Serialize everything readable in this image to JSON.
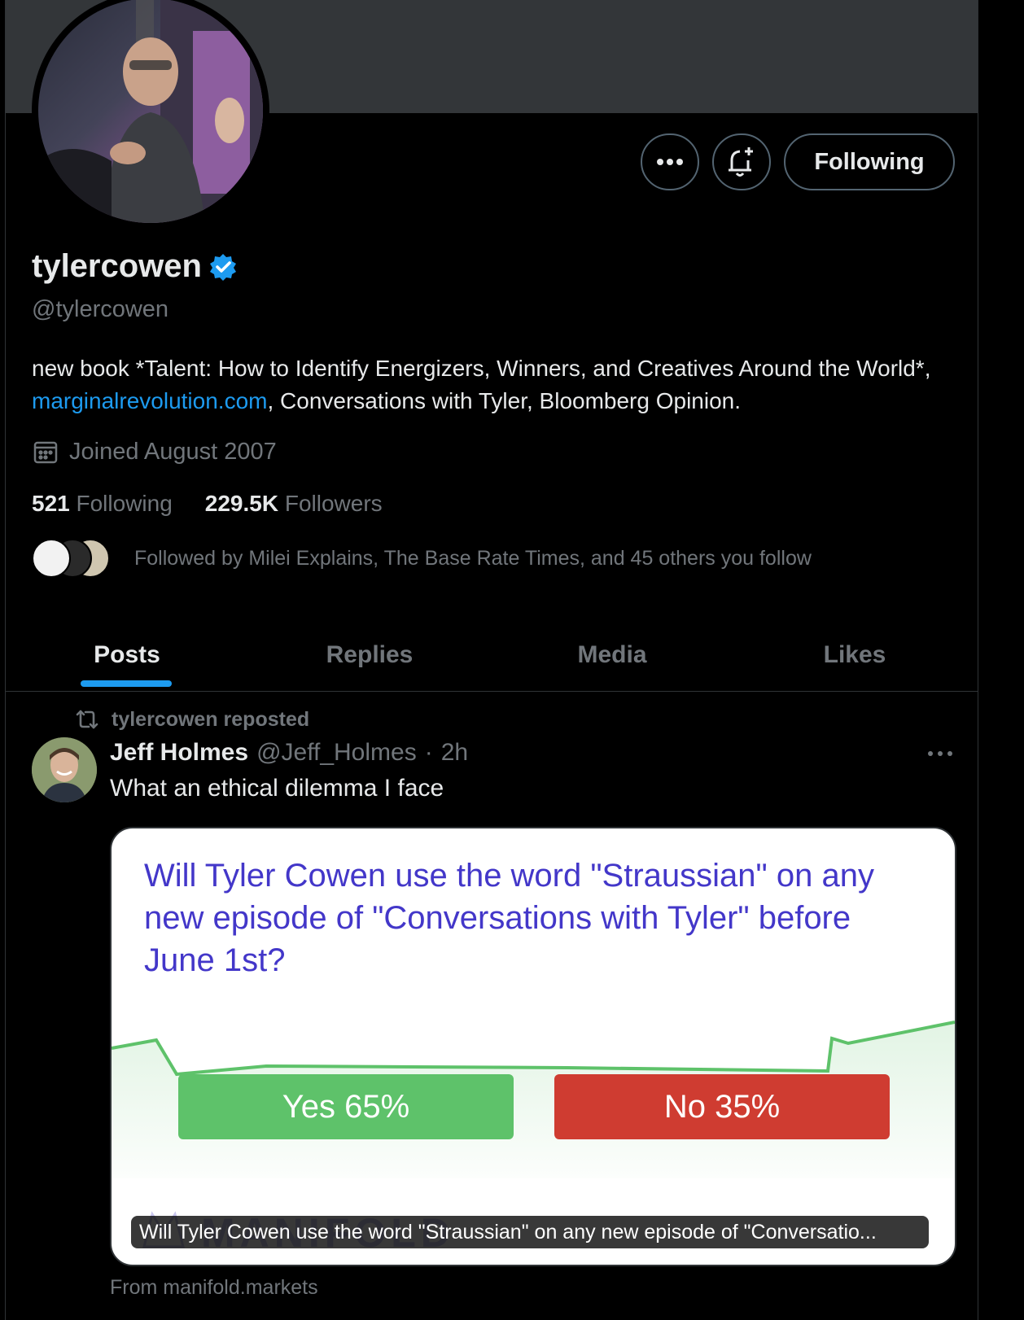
{
  "profile": {
    "display_name": "tylercowen",
    "handle": "@tylercowen",
    "bio_part1": "new book *Talent: How to Identify Energizers, Winners, and Creatives Around the World*, ",
    "bio_link": "marginalrevolution.com",
    "bio_part2": ", Conversations with Tyler, Bloomberg Opinion.",
    "joined": "Joined August 2007",
    "following_count": "521",
    "following_label": "Following",
    "followers_count": "229.5K",
    "followers_label": "Followers",
    "followed_by": "Followed by Milei Explains, The Base Rate Times, and 45 others you follow"
  },
  "actions": {
    "more_icon": "ellipsis-icon",
    "notify_icon": "bell-plus-icon",
    "following_button": "Following"
  },
  "tabs": [
    {
      "label": "Posts",
      "active": true
    },
    {
      "label": "Replies",
      "active": false
    },
    {
      "label": "Media",
      "active": false
    },
    {
      "label": "Likes",
      "active": false
    }
  ],
  "post": {
    "repost_label": "tylercowen reposted",
    "author": "Jeff Holmes",
    "author_handle": "@Jeff_Holmes",
    "separator": "·",
    "time": "2h",
    "text": "What an ethical dilemma I face",
    "card": {
      "question": "Will Tyler Cowen use the word \"Straussian\" on any new episode of \"Conversations with Tyler\" before June 1st?",
      "yes_label": "Yes 65%",
      "no_label": "No 35%",
      "watermark": "MANIFOLD",
      "caption": "Will Tyler Cowen use the word \"Straussian\" on any new episode of \"Conversatio...",
      "source": "From manifold.markets"
    }
  },
  "colors": {
    "accent": "#1d9bf0",
    "muted": "#71767b",
    "yes": "#5ec26a",
    "no": "#cf3c31",
    "question": "#4337c9"
  }
}
